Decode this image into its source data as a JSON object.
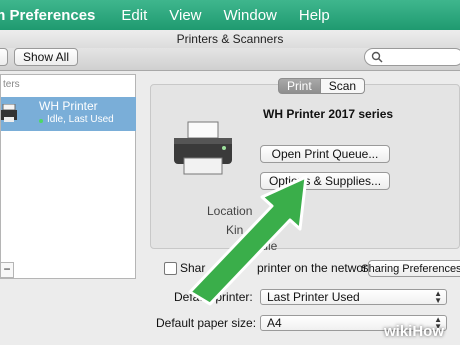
{
  "menubar": {
    "app": "m Preferences",
    "items": [
      "Edit",
      "View",
      "Window",
      "Help"
    ]
  },
  "window": {
    "title": "Printers & Scanners"
  },
  "toolbar": {
    "show_all_label": "Show All",
    "search_placeholder": ""
  },
  "sidebar": {
    "header": "ters",
    "printer": {
      "name": "WH Printer",
      "status": "Idle, Last Used"
    },
    "remove_label": "−"
  },
  "detail": {
    "tabs": [
      "Print",
      "Scan"
    ],
    "printer_title": "WH Printer 2017 series",
    "open_queue_label": "Open Print Queue...",
    "options_label": "Options & Supplies...",
    "location_label": "Location",
    "kind_label": "Kin",
    "status_label": "Idle"
  },
  "share": {
    "label_left": "Shar",
    "label_right": "printer on the network",
    "sharing_prefs_label": "Sharing Preferences..."
  },
  "defaults": {
    "printer_label": "Default printer:",
    "printer_value": "Last Printer Used",
    "paper_label": "Default paper size:",
    "paper_value": "A4"
  },
  "watermark": "wikiHow",
  "colors": {
    "menubar": "#22a06f",
    "arrow": "#3aae4a",
    "selection": "#7aaed8"
  }
}
